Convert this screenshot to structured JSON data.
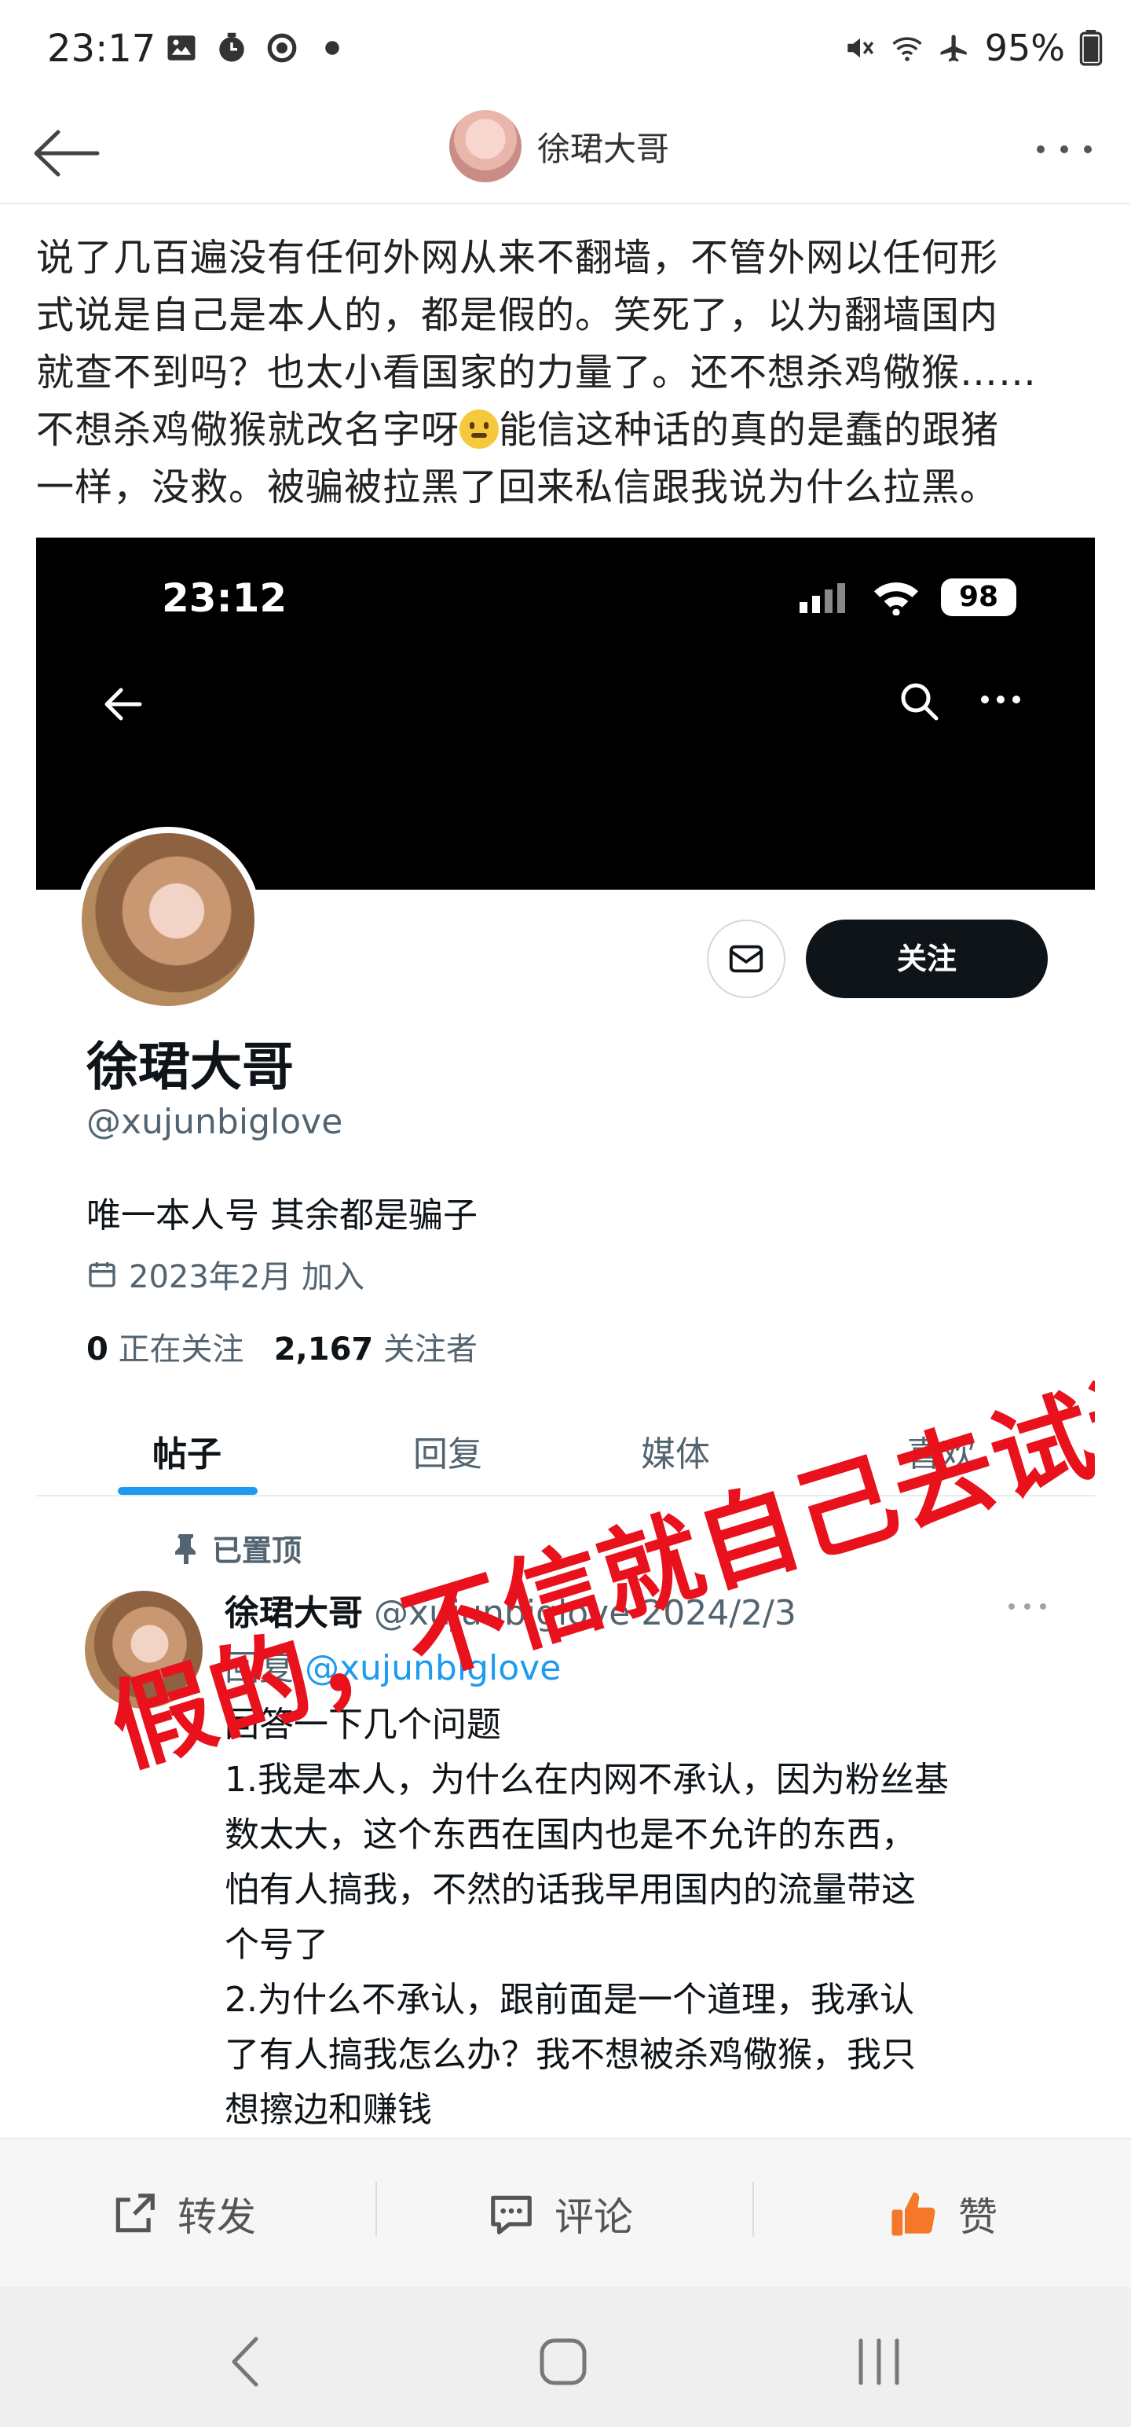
{
  "status_bar": {
    "time": "23:17",
    "battery": "95%",
    "icons_left": [
      "image-icon",
      "timer-icon",
      "sync-icon",
      "dot-icon"
    ],
    "icons_right": [
      "mute-icon",
      "wifi-icon",
      "airplane-icon",
      "battery-icon"
    ]
  },
  "header": {
    "title": "徐珺大哥"
  },
  "post": {
    "line1": "说了几百遍没有任何外网从来不翻墙，不管外网以任何形",
    "line2": "式说是自己是本人的，都是假的。笑死了，以为翻墙国内",
    "line3": "就查不到吗？也太小看国家的力量了。还不想杀鸡儆猴……",
    "line4a": "不想杀鸡儆猴就改名字呀",
    "line4b": "能信这种话的真的是蠢的跟猪",
    "line5": "一样，没救。被骗被拉黑了回来私信跟我说为什么拉黑。"
  },
  "screenshot": {
    "time": "23:12",
    "battery": "98",
    "follow_label": "关注",
    "name": "徐珺大哥",
    "handle": "@xujunbiglove",
    "bio": "唯一本人号 其余都是骗子",
    "joined": "2023年2月 加入",
    "following_count": "0",
    "following_label": "正在关注",
    "followers_count": "2,167",
    "followers_label": "关注者",
    "tabs": [
      "帖子",
      "回复",
      "媒体",
      "喜欢"
    ],
    "pinned_label": "已置顶",
    "tweet": {
      "author": "徐珺大哥",
      "handle": "@xujunbiglove",
      "date": "2024/2/3",
      "reply_prefix": "回复",
      "reply_to": "@xujunbiglove",
      "body": "回答一下几个问题\n1.我是本人，为什么在内网不承认，因为粉丝基\n数太大，这个东西在国内也是不允许的东西，\n怕有人搞我，不然的话我早用国内的流量带这\n个号了\n2.为什么不承认，跟前面是一个道理，我承认\n了有人搞我怎么办？我不想被杀鸡儆猴，我只\n想擦边和赚钱"
    },
    "overlay_text": "假的，不信就自己去试试"
  },
  "actions": {
    "repost": "转发",
    "comment": "评论",
    "like": "赞"
  },
  "colors": {
    "accent_blue": "#1d9bf0",
    "overlay_red": "#e8111c",
    "like_orange": "#f5782a"
  }
}
